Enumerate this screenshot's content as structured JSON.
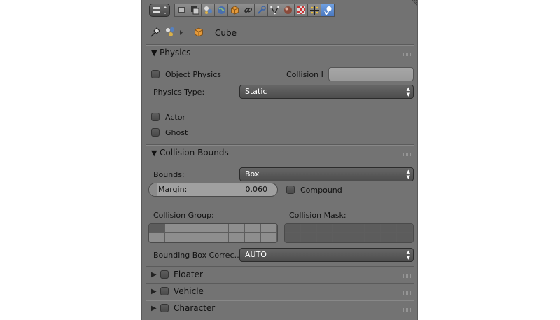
{
  "toolbar": {
    "editor_icon": "properties-editor-icon",
    "tabs": [
      {
        "name": "render-icon",
        "active": false
      },
      {
        "name": "render-layers-icon",
        "active": false
      },
      {
        "name": "scene-icon",
        "active": false
      },
      {
        "name": "world-icon",
        "active": false
      },
      {
        "name": "object-icon",
        "active": false
      },
      {
        "name": "constraints-icon",
        "active": false
      },
      {
        "name": "modifiers-icon",
        "active": false
      },
      {
        "name": "data-icon",
        "active": false
      },
      {
        "name": "material-icon",
        "active": false
      },
      {
        "name": "texture-icon",
        "active": false
      },
      {
        "name": "particles-icon",
        "active": false
      },
      {
        "name": "physics-icon",
        "active": true
      }
    ]
  },
  "context": {
    "pin_icon": "pin-icon",
    "scene_icon": "scene-icon",
    "object_icon": "cube-icon",
    "object_name": "Cube"
  },
  "physics": {
    "title": "Physics",
    "object_physics_label": "Object Physics",
    "object_physics_checked": false,
    "collision_label": "Collision I",
    "collision_value": "",
    "physics_type_label": "Physics Type:",
    "physics_type_value": "Static",
    "actor_label": "Actor",
    "actor_checked": false,
    "ghost_label": "Ghost",
    "ghost_checked": false
  },
  "collision_bounds": {
    "title": "Collision Bounds",
    "bounds_label": "Bounds:",
    "bounds_value": "Box",
    "margin_label": "Margin:",
    "margin_value": "0.060",
    "margin_fraction": 0.06,
    "compound_label": "Compound",
    "compound_checked": false,
    "collision_group_label": "Collision Group:",
    "collision_mask_label": "Collision Mask:",
    "collision_group_on": [
      true,
      false,
      false,
      false,
      false,
      false,
      false,
      false,
      false,
      false,
      false,
      false,
      false,
      false,
      false,
      false
    ],
    "collision_mask_on": [
      true,
      true,
      true,
      true,
      true,
      true,
      true,
      true,
      true,
      true,
      true,
      true,
      true,
      true,
      true,
      true
    ],
    "bounding_box_label": "Bounding Box Correc…",
    "bounding_box_value": "AUTO"
  },
  "subpanels": [
    {
      "title": "Floater",
      "checked": false
    },
    {
      "title": "Vehicle",
      "checked": false
    },
    {
      "title": "Character",
      "checked": false
    }
  ],
  "colors": {
    "panel_bg": "#737373",
    "active_tab": "#5a88d0",
    "dropdown_bg": "#4d4d4d"
  }
}
